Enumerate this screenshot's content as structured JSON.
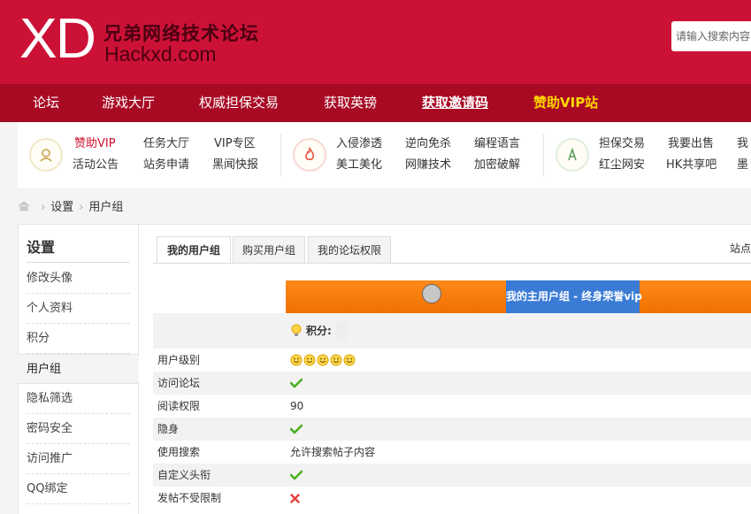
{
  "header": {
    "logo_mark": "XD",
    "logo_cn": "兄弟网络技术论坛",
    "logo_en": "Hackxd.com",
    "search_placeholder": "请输入搜索内容"
  },
  "nav": [
    {
      "label": "论坛"
    },
    {
      "label": "游戏大厅"
    },
    {
      "label": "权威担保交易"
    },
    {
      "label": "获取英镑"
    },
    {
      "label": "获取邀请码"
    },
    {
      "label": "赞助VIP站"
    }
  ],
  "quick": {
    "group1": [
      "赞助VIP",
      "任务大厅",
      "VIP专区",
      "活动公告",
      "站务申请",
      "黑闻快报"
    ],
    "group2": [
      "入侵渗透",
      "逆向免杀",
      "编程语言",
      "美工美化",
      "网赚技术",
      "加密破解"
    ],
    "group3": [
      "担保交易",
      "我要出售",
      "我",
      "红尘网安",
      "HK共享吧",
      "墨"
    ]
  },
  "breadcrumb": {
    "items": [
      "设置",
      "用户组"
    ]
  },
  "sidebar": {
    "title": "设置",
    "items": [
      "修改头像",
      "个人资料",
      "积分",
      "用户组",
      "隐私筛选",
      "密码安全",
      "访问推广",
      "QQ绑定"
    ]
  },
  "tabs": [
    "我的用户组",
    "购买用户组",
    "我的论坛权限"
  ],
  "site_info": "站点",
  "group_banner": "我的主用户组 - 终身荣誉vip",
  "points_label": "积分:",
  "rows": [
    {
      "label": "用户级别",
      "value": "",
      "kind": "smileys",
      "count": 5
    },
    {
      "label": "访问论坛",
      "value": "",
      "kind": "check"
    },
    {
      "label": "阅读权限",
      "value": "90",
      "kind": "text"
    },
    {
      "label": "隐身",
      "value": "",
      "kind": "check"
    },
    {
      "label": "使用搜索",
      "value": "允许搜索帖子内容",
      "kind": "text"
    },
    {
      "label": "自定义头衔",
      "value": "",
      "kind": "check"
    },
    {
      "label": "发帖不受限制",
      "value": "",
      "kind": "cross"
    }
  ]
}
